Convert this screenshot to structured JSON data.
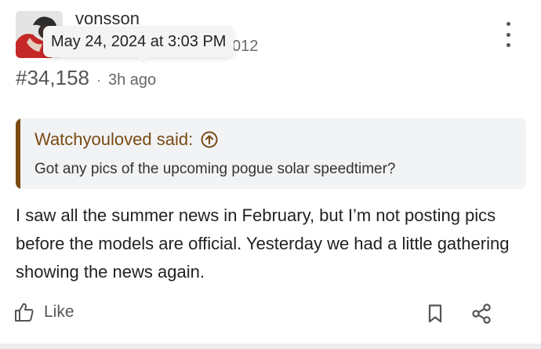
{
  "author": {
    "username": "vonsson",
    "joined_partial": "012",
    "avatar_icon": "user-avatar-photo"
  },
  "tooltip": {
    "datetime": "May 24, 2024 at 3:03 PM"
  },
  "post": {
    "number": "#34,158",
    "separator": "·",
    "relative_time": "3h ago",
    "menu_icon": "kebab-menu-icon"
  },
  "quote": {
    "author": "Watchyouloved said:",
    "expand_icon": "arrow-up-circle-icon",
    "text": "Got any pics of the upcoming pogue solar speedtimer?",
    "accent_color": "#7a4a12"
  },
  "message": {
    "text": "I saw all the summer news in February, but I’m not posting pics before the models are official. Yesterday we had a little gathering showing the news again."
  },
  "actions": {
    "like_label": "Like",
    "like_icon": "thumbs-up-icon",
    "bookmark_icon": "bookmark-icon",
    "share_icon": "share-icon"
  }
}
